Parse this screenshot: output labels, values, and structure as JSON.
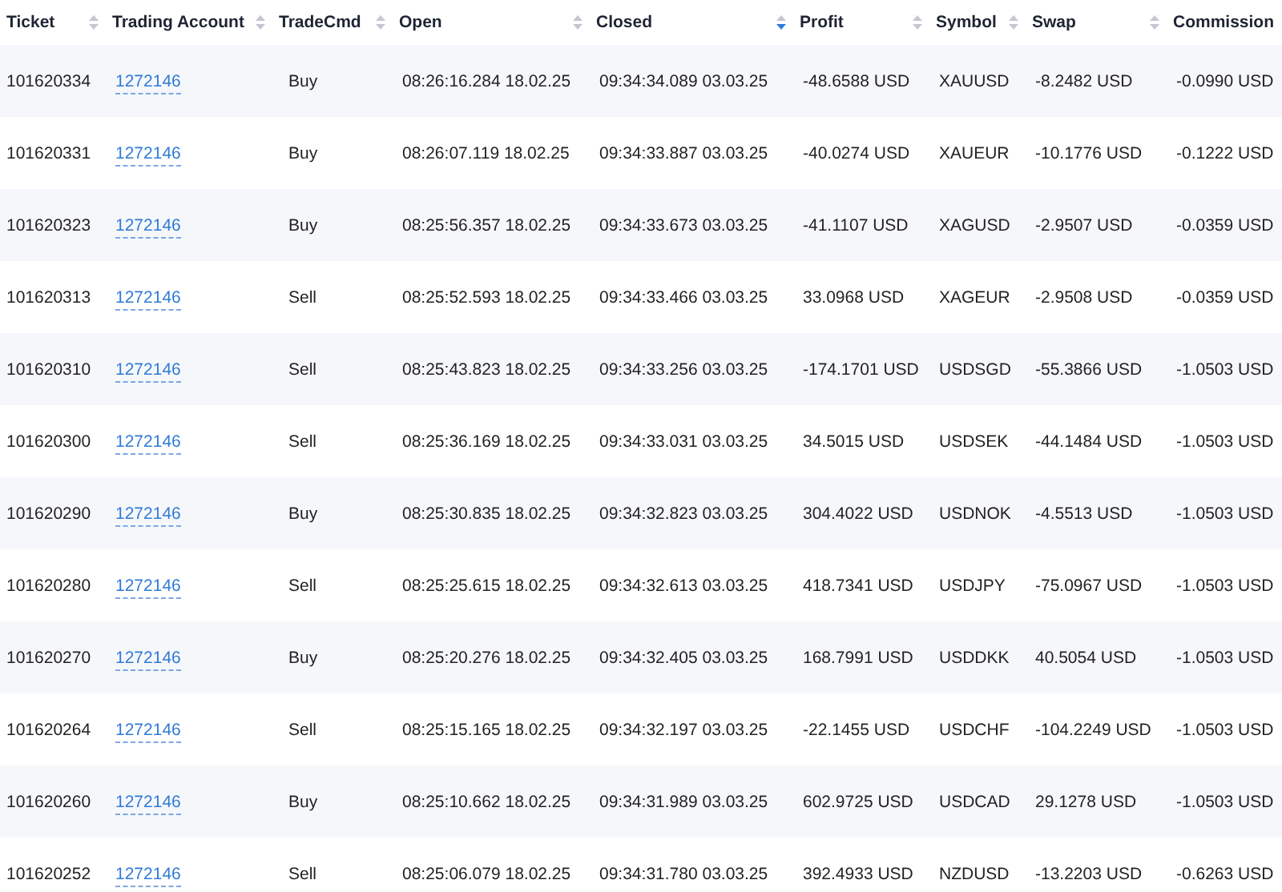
{
  "table": {
    "columns": [
      {
        "label": "Ticket",
        "sorted": false
      },
      {
        "label": "Trading Account",
        "sorted": false
      },
      {
        "label": "TradeCmd",
        "sorted": false
      },
      {
        "label": "Open",
        "sorted": false
      },
      {
        "label": "Closed",
        "sorted": true
      },
      {
        "label": "Profit",
        "sorted": false
      },
      {
        "label": "Symbol",
        "sorted": false
      },
      {
        "label": "Swap",
        "sorted": false
      },
      {
        "label": "Commission"
      }
    ],
    "rows": [
      [
        "101620334",
        "1272146",
        "Buy",
        "08:26:16.284 18.02.25",
        "09:34:34.089 03.03.25",
        "-48.6588 USD",
        "XAUUSD",
        "-8.2482 USD",
        "-0.0990 USD"
      ],
      [
        "101620331",
        "1272146",
        "Buy",
        "08:26:07.119 18.02.25",
        "09:34:33.887 03.03.25",
        "-40.0274 USD",
        "XAUEUR",
        "-10.1776 USD",
        "-0.1222 USD"
      ],
      [
        "101620323",
        "1272146",
        "Buy",
        "08:25:56.357 18.02.25",
        "09:34:33.673 03.03.25",
        "-41.1107 USD",
        "XAGUSD",
        "-2.9507 USD",
        "-0.0359 USD"
      ],
      [
        "101620313",
        "1272146",
        "Sell",
        "08:25:52.593 18.02.25",
        "09:34:33.466 03.03.25",
        "33.0968 USD",
        "XAGEUR",
        "-2.9508 USD",
        "-0.0359 USD"
      ],
      [
        "101620310",
        "1272146",
        "Sell",
        "08:25:43.823 18.02.25",
        "09:34:33.256 03.03.25",
        "-174.1701 USD",
        "USDSGD",
        "-55.3866 USD",
        "-1.0503 USD"
      ],
      [
        "101620300",
        "1272146",
        "Sell",
        "08:25:36.169 18.02.25",
        "09:34:33.031 03.03.25",
        "34.5015 USD",
        "USDSEK",
        "-44.1484 USD",
        "-1.0503 USD"
      ],
      [
        "101620290",
        "1272146",
        "Buy",
        "08:25:30.835 18.02.25",
        "09:34:32.823 03.03.25",
        "304.4022 USD",
        "USDNOK",
        "-4.5513 USD",
        "-1.0503 USD"
      ],
      [
        "101620280",
        "1272146",
        "Sell",
        "08:25:25.615 18.02.25",
        "09:34:32.613 03.03.25",
        "418.7341 USD",
        "USDJPY",
        "-75.0967 USD",
        "-1.0503 USD"
      ],
      [
        "101620270",
        "1272146",
        "Buy",
        "08:25:20.276 18.02.25",
        "09:34:32.405 03.03.25",
        "168.7991 USD",
        "USDDKK",
        "40.5054 USD",
        "-1.0503 USD"
      ],
      [
        "101620264",
        "1272146",
        "Sell",
        "08:25:15.165 18.02.25",
        "09:34:32.197 03.03.25",
        "-22.1455 USD",
        "USDCHF",
        "-104.2249 USD",
        "-1.0503 USD"
      ],
      [
        "101620260",
        "1272146",
        "Buy",
        "08:25:10.662 18.02.25",
        "09:34:31.989 03.03.25",
        "602.9725 USD",
        "USDCAD",
        "29.1278 USD",
        "-1.0503 USD"
      ],
      [
        "101620252",
        "1272146",
        "Sell",
        "08:25:06.079 18.02.25",
        "09:34:31.780 03.03.25",
        "392.4933 USD",
        "NZDUSD",
        "-13.2203 USD",
        "-0.6263 USD"
      ]
    ]
  }
}
